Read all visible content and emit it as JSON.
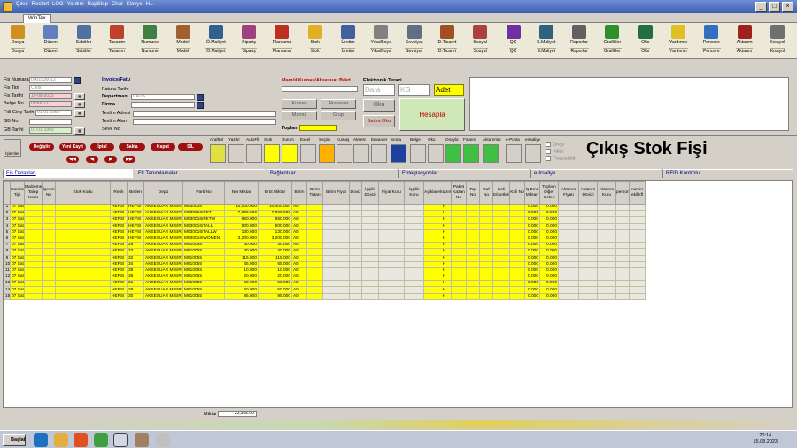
{
  "titlebar": {
    "menu": [
      "Çıkış",
      "Restart",
      "LOG",
      "Yardım",
      "RapStop",
      "Chat",
      "Klavye",
      "H..."
    ]
  },
  "tab": "WinTex",
  "toolbar": [
    {
      "label": "Dosya",
      "dd": "Dosya",
      "icon": "folder-icon",
      "color": "#d09020"
    },
    {
      "label": "Düzen",
      "dd": "Düzen",
      "icon": "pencil-icon",
      "color": "#6080c0"
    },
    {
      "label": "Sabitler",
      "dd": "Sabitler",
      "icon": "anchor-icon",
      "color": "#5070a0"
    },
    {
      "label": "Tasarım",
      "dd": "Tasarım",
      "icon": "design-icon",
      "color": "#c04030"
    },
    {
      "label": "Numune",
      "dd": "Numune",
      "icon": "sample-icon",
      "color": "#408040"
    },
    {
      "label": "Model",
      "dd": "Model",
      "icon": "model-icon",
      "color": "#a06030"
    },
    {
      "label": "Ö.Maliyet",
      "dd": "Ö.Maliyet",
      "icon": "cost-icon",
      "color": "#306090"
    },
    {
      "label": "Sipariş",
      "dd": "Sipariş",
      "icon": "order-icon",
      "color": "#a04080"
    },
    {
      "label": "Planlama",
      "dd": "Planlama",
      "icon": "gear-icon",
      "color": "#c03020"
    },
    {
      "label": "Stok",
      "dd": "Stok",
      "icon": "star-icon",
      "color": "#e0b020"
    },
    {
      "label": "Üretim",
      "dd": "Üretim",
      "icon": "production-icon",
      "color": "#4060a0"
    },
    {
      "label": "Yıka/Boya",
      "dd": "Yıka/Boya",
      "icon": "cube-icon",
      "color": "#808080"
    },
    {
      "label": "Sevkiyat",
      "dd": "Sevkiyat",
      "icon": "shipping-icon",
      "color": "#607080"
    },
    {
      "label": "D.Ticaret",
      "dd": "D.Ticaret",
      "icon": "trade-icon",
      "color": "#a05020"
    },
    {
      "label": "Sosyal",
      "dd": "Sosyal",
      "icon": "social-icon",
      "color": "#b04040"
    },
    {
      "label": "QC",
      "dd": "QC",
      "icon": "qc-icon",
      "color": "#7030a0"
    },
    {
      "label": "S.Maliyet",
      "dd": "S.Maliyet",
      "icon": "chart-icon",
      "color": "#306080"
    },
    {
      "label": "Raporlar",
      "dd": "Raporlar",
      "icon": "report-icon",
      "color": "#606060"
    },
    {
      "label": "Grafikler",
      "dd": "Grafikler",
      "icon": "graph-icon",
      "color": "#309030"
    },
    {
      "label": "Ofis",
      "dd": "Ofis",
      "icon": "excel-icon",
      "color": "#207040"
    },
    {
      "label": "Yardımcı",
      "dd": "Yardımcı",
      "icon": "smiley-icon",
      "color": "#e0c020"
    },
    {
      "label": "Pencere",
      "dd": "Pencere",
      "icon": "window-icon",
      "color": "#3070c0"
    },
    {
      "label": "Aktarım",
      "dd": "Aktarım",
      "icon": "transfer-icon",
      "color": "#a02020"
    },
    {
      "label": "Kısayol",
      "dd": "Kısayol",
      "icon": "wrench-icon",
      "color": "#707070"
    }
  ],
  "header": {
    "fis_no_label": "Fiş Numarası",
    "fis_no": "0001930012",
    "fis_tipi_label": "Fiş Tipi",
    "fis_tipi": "Çıkış",
    "fis_tarihi_label": "Fiş Tarihi",
    "fis_tarihi": "15-08-2023",
    "belge_no_label": "Belge No",
    "belge_no": "0930012",
    "fire_label": "Fiili Giriş Tarih",
    "fire": "01-01-1950",
    "gb_no_label": "GB No",
    "gb_tarihi_label": "GB Tarihi",
    "gb_tarihi": "01-01-1950",
    "invoice_label": "Invoice/Fatu",
    "fatura_tarihi_label": "Fatura Tarihi",
    "departman_label": "Departman",
    "departman": "CATIS",
    "firma_label": "Firma",
    "teslim_adresi_label": "Teslim Adresi",
    "teslim_alan_label": "Teslim Alan",
    "sevk_no_label": "Sevk No",
    "mamul_label": "Mamül/Kumaş/Aksesuar Brkd",
    "kumas": "Kumaş",
    "aksesuar": "Aksesuar",
    "mamul": "Mamül",
    "grup": "Grup",
    "toplam_label": "Toplam",
    "terazi_label": "Elektronik Terazi",
    "dara": "Dara",
    "kg": "KG",
    "adet": "Adet",
    "oku": "Oku",
    "satira_oku": "Satıra Oku",
    "hesapla": "Hesapla",
    "islemler": "İşlemler"
  },
  "actions": {
    "degistir": "Değiştir",
    "yeni_kayit": "Yeni Kayıt",
    "iptal": "İptal",
    "sakla": "Sakla",
    "kapat": "Kapat",
    "sil": "SİL"
  },
  "icons": [
    {
      "label": "Ara/Bul",
      "name": "search-binoculars-icon",
      "color": "#e0e040"
    },
    {
      "label": "Yazdır",
      "name": "printer-icon",
      "color": "#d4d0c8"
    },
    {
      "label": "AutoFill",
      "name": "autofill-icon",
      "color": "#d4d0c8"
    },
    {
      "label": "Stok",
      "name": "stock-icon",
      "color": "#ffff00"
    },
    {
      "label": "Durum",
      "name": "status-icon",
      "color": "#ffff00"
    },
    {
      "label": "Excel",
      "name": "excel-icon",
      "color": "#d4d0c8"
    },
    {
      "label": "Seçim",
      "name": "select-icon",
      "color": "#ffb000"
    },
    {
      "label": "Kumaş",
      "name": "fabric-icon",
      "color": "#d4d0c8"
    },
    {
      "label": "Aksesr",
      "name": "accessory-icon",
      "color": "#d4d0c8"
    },
    {
      "label": "Envanter",
      "name": "inventory-icon",
      "color": "#d4d0c8"
    },
    {
      "label": "Sırala",
      "name": "sort-icon",
      "color": "#2040a0"
    },
    {
      "label": "Belge",
      "name": "document-icon",
      "color": "#d4d0c8"
    },
    {
      "label": "Oku",
      "name": "read-icon",
      "color": "#d4d0c8"
    },
    {
      "label": "Onayla",
      "name": "approve-icon",
      "color": "#40c040"
    },
    {
      "label": "Finans",
      "name": "finance-icon",
      "color": "#40c040"
    },
    {
      "label": "Aktarımlar",
      "name": "transfers-icon",
      "color": "#40c040"
    },
    {
      "label": "e-Posta",
      "name": "email-icon",
      "color": "#d4d0c8"
    },
    {
      "label": "eIrsaliye",
      "name": "eirsaliye-icon",
      "color": "#d4d0c8"
    }
  ],
  "checks": [
    "Onay",
    "Kilitle",
    "FinansKilit"
  ],
  "title": "Çıkış Stok Fişi",
  "tabs": [
    "Fiş Detayları",
    "Ek Tanımlamalar",
    "Bağlantılar",
    "Entegrasyonlar",
    "e-Irsaliye",
    "RFID Kontrolu"
  ],
  "columns": [
    "",
    "Hareket Tipi",
    "Malzeme Talep Kodu",
    "İşemri No",
    "Stok Kodu",
    "Renk",
    "Beden",
    "Depo",
    "Parti No",
    "Net Miktar",
    "Brüt Miktar",
    "Birim",
    "Birim Tutarı",
    "Birim Fiyat",
    "Doviz",
    "İşçilik Dövizi",
    "Fiyat Kuru",
    "İşçilik Kuru",
    "Açıklama",
    "Aktarıma",
    "Paket Kazan No",
    "Top No",
    "Raf No",
    "Koli Etiketleri",
    "Koli No",
    "İş Emri Miktarı",
    "Toplam Diğer Gelen",
    "Aktarım Fiyatı",
    "Aktarım Dövizi",
    "Aktarım Kuru",
    "personel",
    "nomin ekilikfl"
  ],
  "rows": [
    [
      "1",
      "07 Satis",
      "HEPSI",
      "HEPSI",
      "AKSESUAR MISIR",
      "M930016",
      "10,400.000",
      "10,400.000",
      "AD",
      "0.000",
      "0.000"
    ],
    [
      "2",
      "07 Satis",
      "HEPSI",
      "HEPSI",
      "AKSESUAR MISIR",
      "M930016/PET",
      "7,000.000",
      "7,000.000",
      "AD",
      "0.000",
      "0.000"
    ],
    [
      "3",
      "07 Satis",
      "HEPSI",
      "HEPSI",
      "AKSESUAR MISIR",
      "M930016/PETW",
      "650.000",
      "650.000",
      "AD",
      "0.000",
      "0.000"
    ],
    [
      "4",
      "07 Satis",
      "HEPSI",
      "HEPSI",
      "AKSESUAR MISIR",
      "M930016/TALL",
      "500.000",
      "500.000",
      "AD",
      "0.000",
      "0.000"
    ],
    [
      "5",
      "07 Satis",
      "HEPSI",
      "HEPSI",
      "AKSESUAR MISIR",
      "M930016/TALLW",
      "130.000",
      "130.000",
      "AD",
      "0.000",
      "0.000"
    ],
    [
      "6",
      "07 Satis",
      "HEPSI",
      "HEPSI",
      "AKSESUAR MISIR",
      "M930016/WOMEN",
      "3,200.000",
      "3,200.000",
      "AD",
      "0.000",
      "0.000"
    ],
    [
      "7",
      "07 Satis",
      "HEPSI",
      "28",
      "AKSESUAR MISIR",
      "M610055",
      "30.000",
      "30.000",
      "AD",
      "0.000",
      "0.000"
    ],
    [
      "8",
      "07 Satis",
      "HEPSI",
      "33",
      "AKSESUAR MISIR",
      "M610055",
      "40.000",
      "40.000",
      "AD",
      "0.000",
      "0.000"
    ],
    [
      "9",
      "07 Satis",
      "HEPSI",
      "32",
      "AKSESUAR MISIR",
      "M610055",
      "115.000",
      "115.000",
      "AD",
      "0.000",
      "0.000"
    ],
    [
      "10",
      "07 Satis",
      "HEPSI",
      "34",
      "AKSESUAR MISIR",
      "M610055",
      "65.000",
      "65.000",
      "AD",
      "0.000",
      "0.000"
    ],
    [
      "11",
      "07 Satis",
      "HEPSI",
      "38",
      "AKSESUAR MISIR",
      "M610055",
      "10.000",
      "10.000",
      "AD",
      "0.000",
      "0.000"
    ],
    [
      "12",
      "07 Satis",
      "HEPSI",
      "36",
      "AKSESUAR MISIR",
      "M610055",
      "20.000",
      "20.000",
      "AD",
      "0.000",
      "0.000"
    ],
    [
      "13",
      "07 Satis",
      "HEPSI",
      "31",
      "AKSESUAR MISIR",
      "M610055",
      "50.000",
      "50.000",
      "AD",
      "0.000",
      "0.000"
    ],
    [
      "14",
      "07 Satis",
      "HEPSI",
      "29",
      "AKSESUAR MISIR",
      "M610055",
      "50.000",
      "50.000",
      "AD",
      "0.000",
      "0.000"
    ],
    [
      "15",
      "07 Satis",
      "HEPSI",
      "30",
      "AKSESUAR MISIR",
      "M610055",
      "95.000",
      "95.000",
      "AD",
      "0.000",
      "0.000"
    ]
  ],
  "aktarima": "H",
  "footer": {
    "miktar_label": "Miktar",
    "miktar": "22,365.00"
  },
  "taskbar": {
    "start": "Başlat",
    "time": "20:14",
    "date": "15.08.2023"
  }
}
